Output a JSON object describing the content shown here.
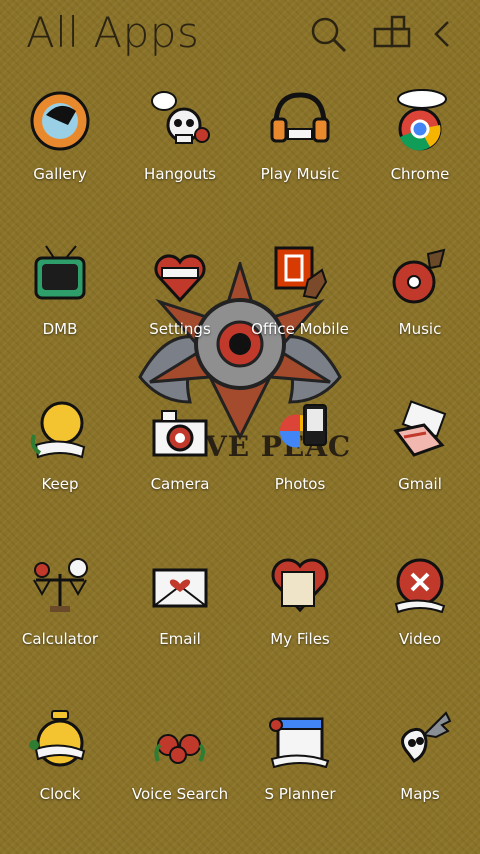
{
  "header": {
    "title": "All Apps"
  },
  "toolbar": {
    "search_icon": "search-icon",
    "grid_icon": "grid-icon",
    "back_icon": "chevron-left-icon"
  },
  "apps": [
    {
      "label": "Gallery",
      "icon": "gallery-icon"
    },
    {
      "label": "Hangouts",
      "icon": "hangouts-icon"
    },
    {
      "label": "Play Music",
      "icon": "play-music-icon"
    },
    {
      "label": "Chrome",
      "icon": "chrome-icon"
    },
    {
      "label": "DMB",
      "icon": "dmb-icon"
    },
    {
      "label": "Settings",
      "icon": "settings-icon"
    },
    {
      "label": "Office Mobile",
      "icon": "office-mobile-icon"
    },
    {
      "label": "Music",
      "icon": "music-icon"
    },
    {
      "label": "Keep",
      "icon": "keep-icon"
    },
    {
      "label": "Camera",
      "icon": "camera-icon"
    },
    {
      "label": "Photos",
      "icon": "photos-icon"
    },
    {
      "label": "Gmail",
      "icon": "gmail-icon"
    },
    {
      "label": "Calculator",
      "icon": "calculator-icon"
    },
    {
      "label": "Email",
      "icon": "email-icon"
    },
    {
      "label": "My Files",
      "icon": "my-files-icon"
    },
    {
      "label": "Video",
      "icon": "video-icon"
    },
    {
      "label": "Clock",
      "icon": "clock-icon"
    },
    {
      "label": "Voice Search",
      "icon": "voice-search-icon"
    },
    {
      "label": "S Planner",
      "icon": "s-planner-icon"
    },
    {
      "label": "Maps",
      "icon": "maps-icon"
    }
  ],
  "wallpaper": {
    "text": "VE PEAC"
  },
  "colors": {
    "background": "#8a7228",
    "title": "#2b2413",
    "label": "#ffffff"
  }
}
